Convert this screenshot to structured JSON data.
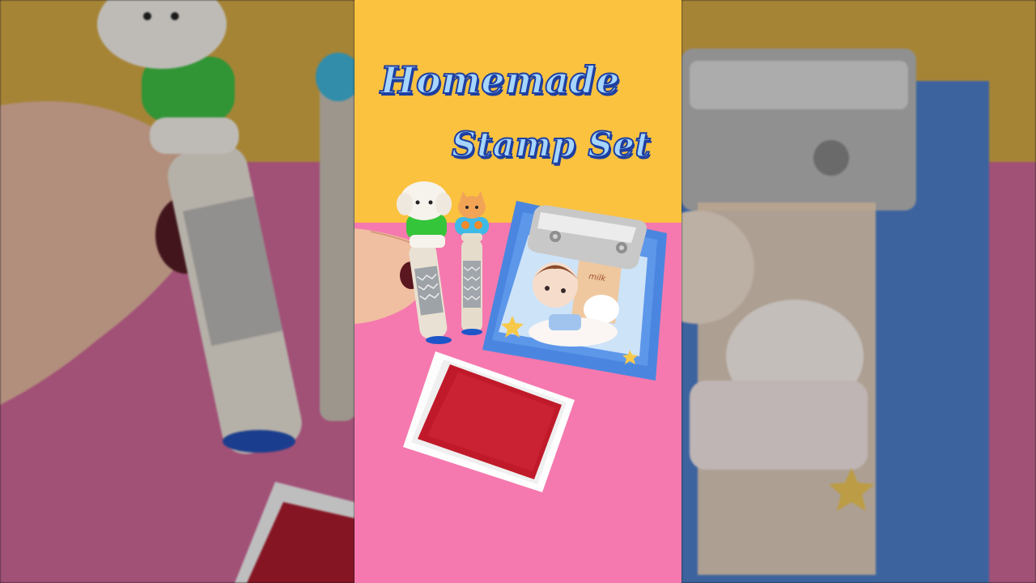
{
  "caption": {
    "line1": "Homemade",
    "line2": "Stamp Set"
  },
  "notebook_label": "milk",
  "colors": {
    "background_yellow": "#fbc23f",
    "background_pink": "#f579ae",
    "title_fill": "#a6d6ff",
    "title_outline": "#1e3fa0",
    "notebook_blue": "#4a86e0",
    "ink_pad_red": "#c01a2a"
  }
}
